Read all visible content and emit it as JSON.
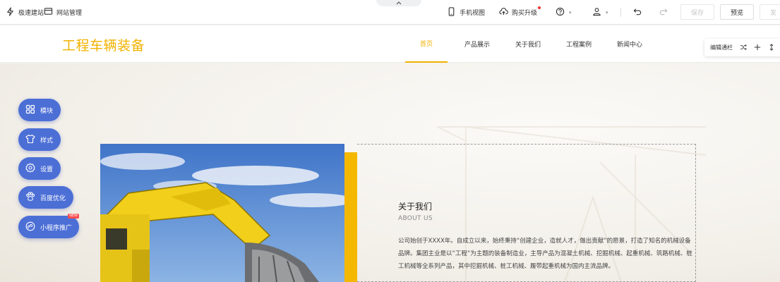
{
  "toolbar": {
    "quick_build": "极速建站",
    "site_manage": "网站管理",
    "mobile_view": "手机视图",
    "buy_upgrade": "购买升级",
    "save": "保存",
    "preview": "预览",
    "publish_partial": "发"
  },
  "site": {
    "logo": "工程车辆装备",
    "nav": [
      "首页",
      "产品展示",
      "关于我们",
      "工程案例",
      "新闻中心"
    ],
    "active_nav": "首页"
  },
  "column_bar": {
    "label": "编辑通栏"
  },
  "side_pills": [
    {
      "label": "模块"
    },
    {
      "label": "样式"
    },
    {
      "label": "设置"
    },
    {
      "label": "百度优化"
    },
    {
      "label": "小程序推广",
      "badge": "NEW"
    }
  ],
  "about": {
    "title": "关于我们",
    "subtitle": "ABOUT US",
    "text": "公司始创于XXXX年。自成立以来，始终秉持“创建企业，造就人才，做出贡献”的愿景，打造了知名的机械设备品牌。集团主业是以“工程”为主题的装备制造业，主导产品为混凝土机械、挖掘机械、起重机械、筑路机械、桩工机械等全系列产品，其中挖掘机械、桩工机械、履带起重机械为国内主流品牌。"
  },
  "colors": {
    "accent": "#f2b200",
    "pill": "#4c6fd6",
    "badge": "#ff4d4f"
  },
  "icons": [
    "lightning-icon",
    "monitor-icon",
    "phone-icon",
    "cloud-upload-icon",
    "help-icon",
    "user-icon",
    "undo-icon",
    "redo-icon",
    "grid-icon",
    "shirt-icon",
    "gear-icon",
    "paw-icon",
    "mini-program-icon",
    "shuffle-icon",
    "plus-icon",
    "arrows-vertical-icon",
    "chevron-up-icon"
  ]
}
